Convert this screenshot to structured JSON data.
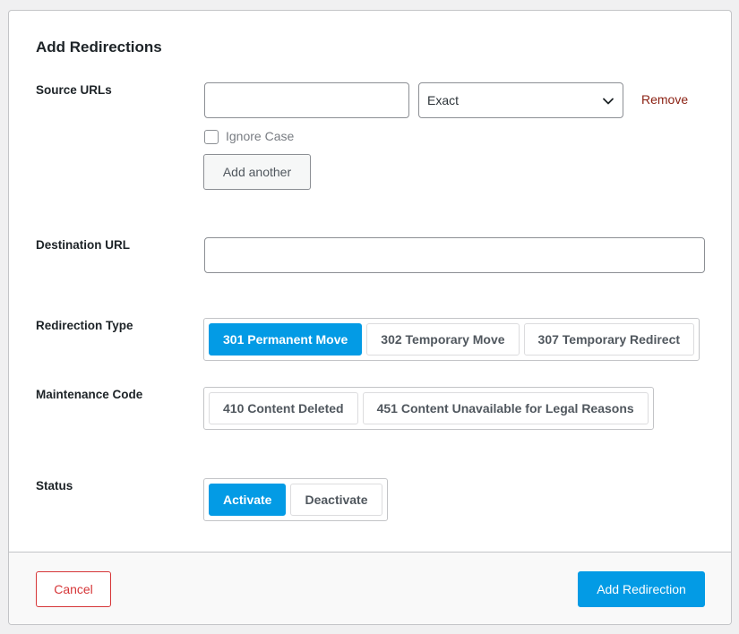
{
  "modal": {
    "title": "Add Redirections"
  },
  "source_urls": {
    "label": "Source URLs",
    "url_value": "",
    "match_type": "Exact",
    "remove_label": "Remove",
    "ignore_case_label": "Ignore Case",
    "ignore_case_checked": false,
    "add_another_label": "Add another"
  },
  "destination": {
    "label": "Destination URL",
    "value": ""
  },
  "redirection_type": {
    "label": "Redirection Type",
    "options": [
      "301 Permanent Move",
      "302 Temporary Move",
      "307 Temporary Redirect"
    ],
    "selected": "301 Permanent Move"
  },
  "maintenance_code": {
    "label": "Maintenance Code",
    "options": [
      "410 Content Deleted",
      "451 Content Unavailable for Legal Reasons"
    ]
  },
  "status": {
    "label": "Status",
    "options": [
      "Activate",
      "Deactivate"
    ],
    "selected": "Activate"
  },
  "footer": {
    "cancel_label": "Cancel",
    "submit_label": "Add Redirection"
  },
  "colors": {
    "accent": "#039be5",
    "danger": "#d63638",
    "remove_link": "#8a1f11"
  }
}
